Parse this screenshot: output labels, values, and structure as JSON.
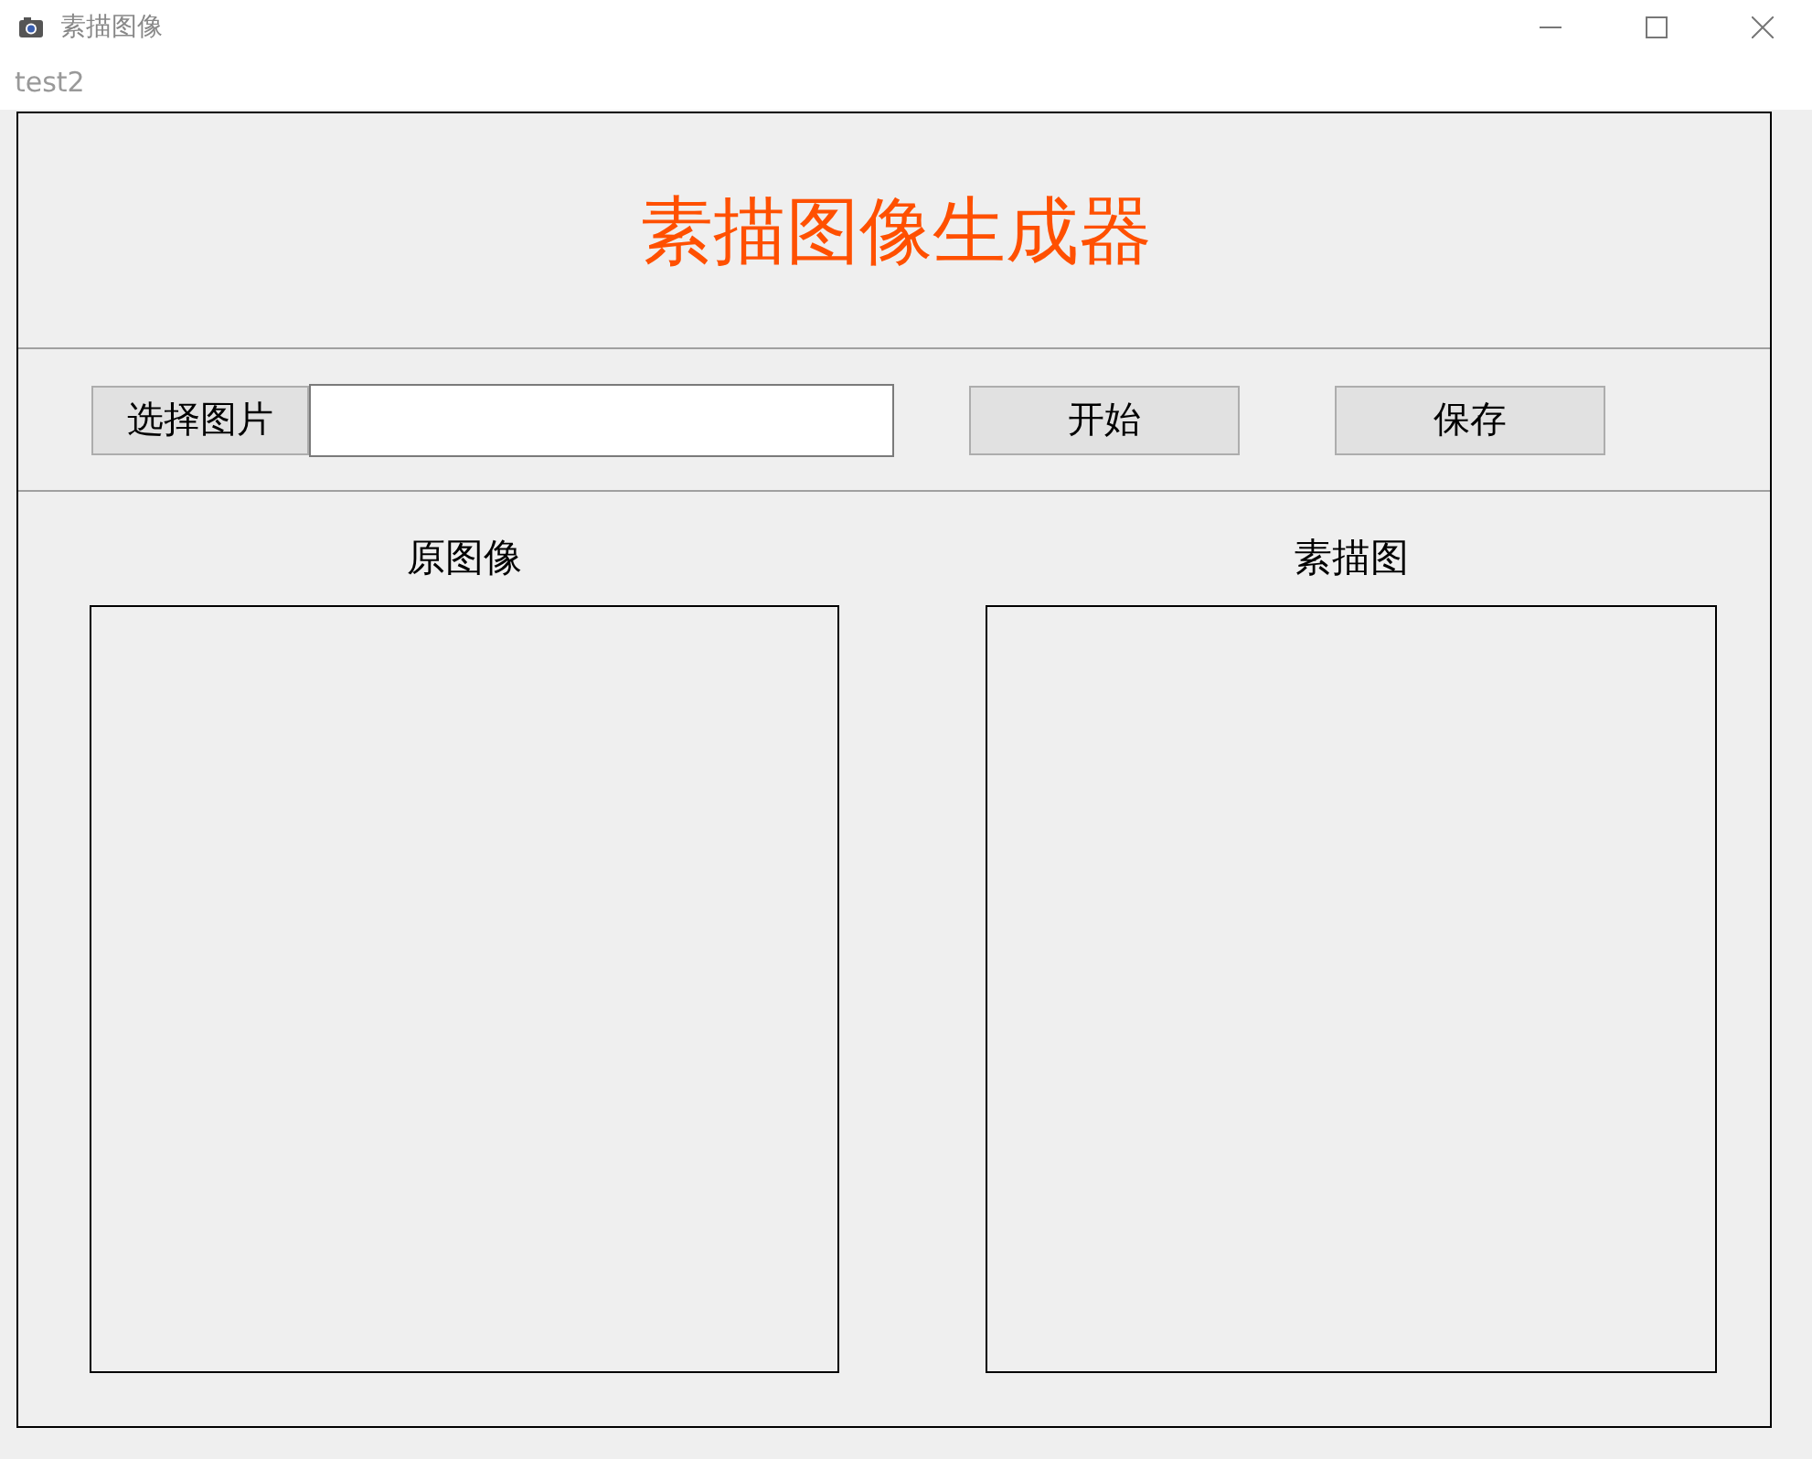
{
  "window": {
    "title": "素描图像",
    "subtitle": "test2"
  },
  "header": {
    "title": "素描图像生成器"
  },
  "controls": {
    "choose_button": "选择图片",
    "start_button": "开始",
    "save_button": "保存"
  },
  "panels": [
    {
      "label": "原图像"
    },
    {
      "label": "素描图"
    }
  ]
}
